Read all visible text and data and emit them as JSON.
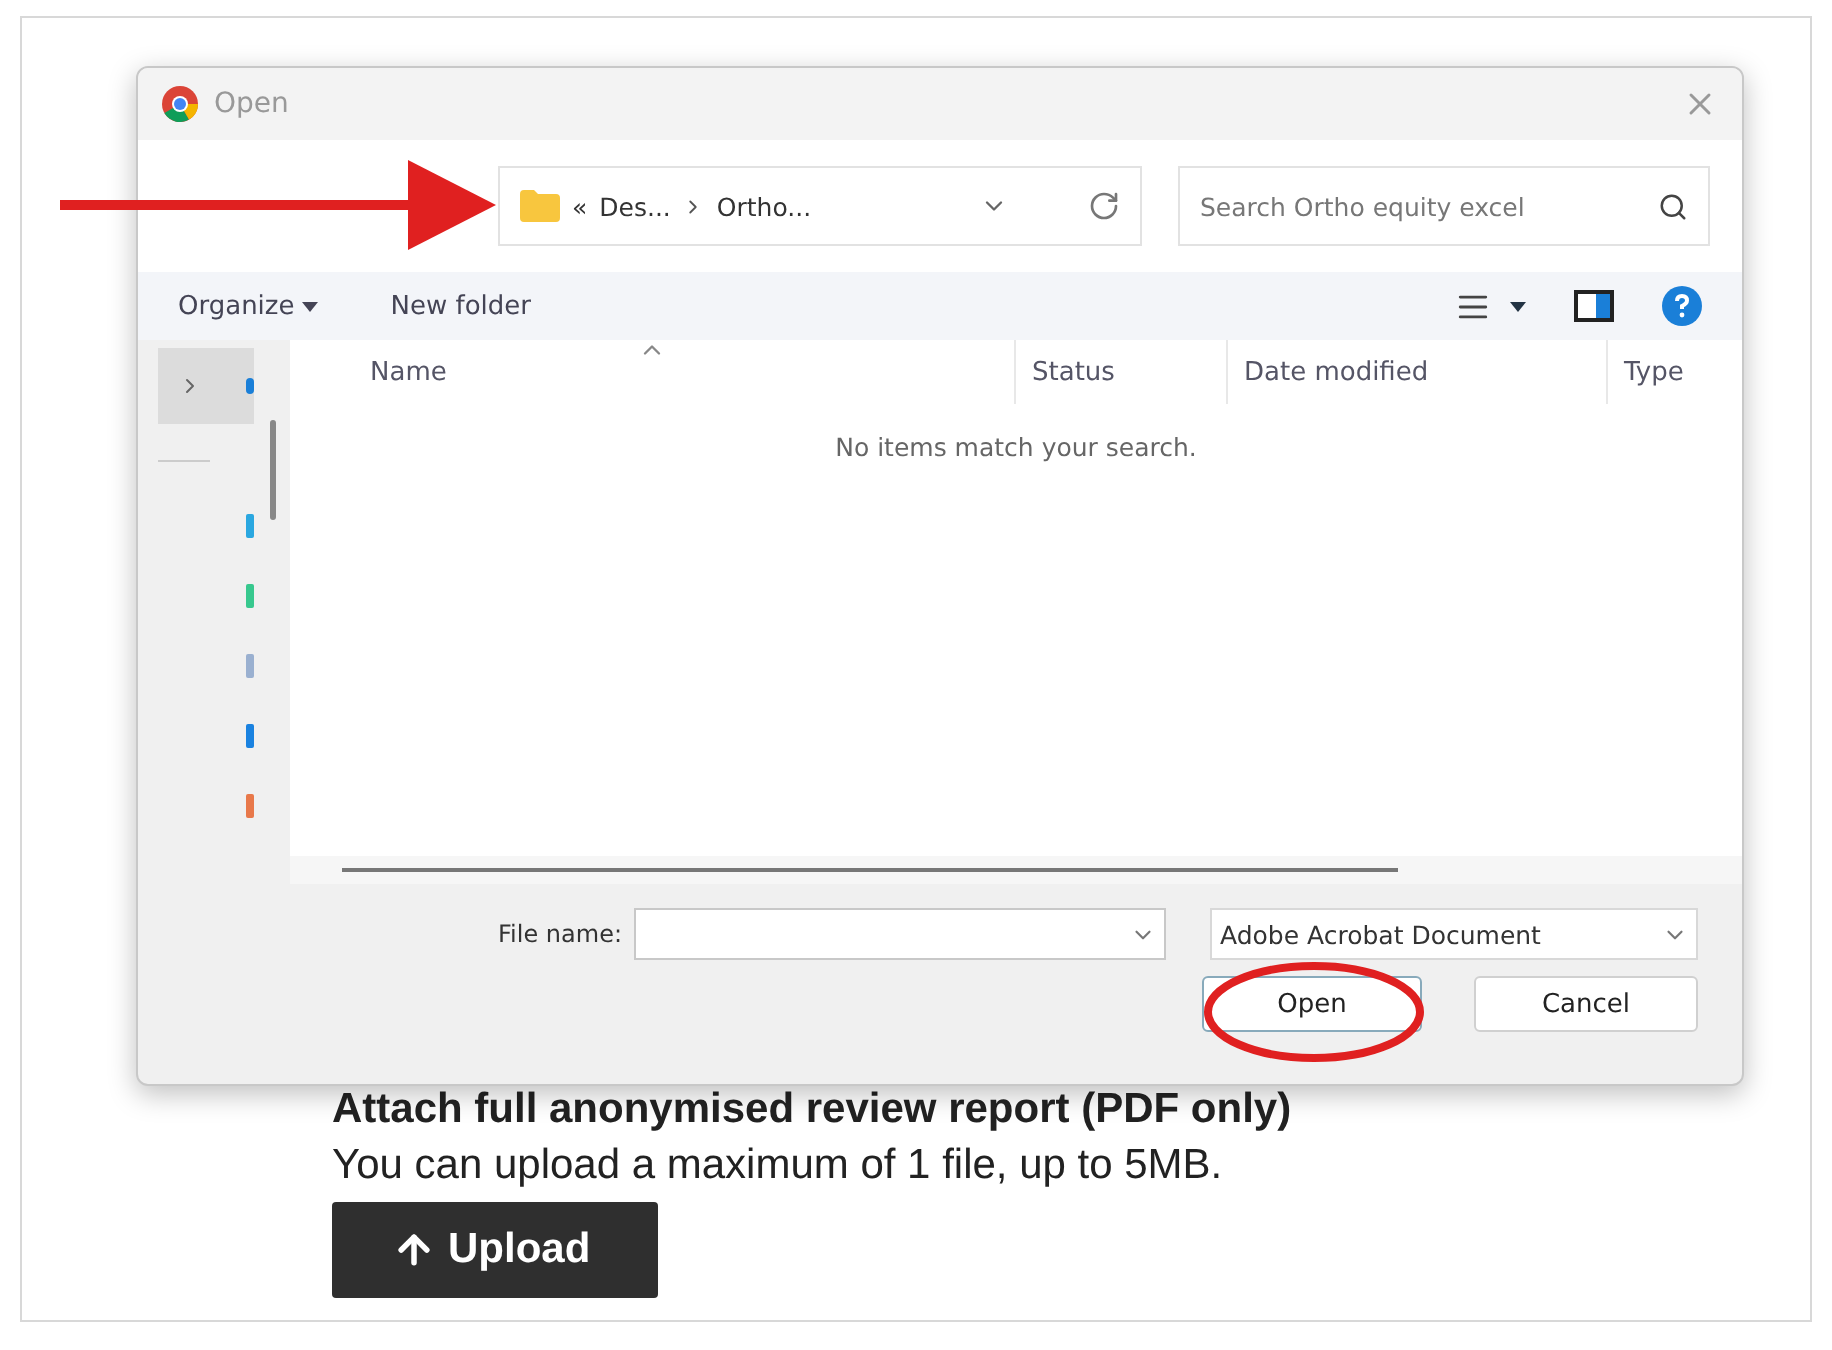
{
  "dialog": {
    "title": "Open",
    "address": {
      "overflow": "«",
      "segments": [
        "Des...",
        "Ortho..."
      ]
    },
    "search": {
      "placeholder": "Search Ortho equity excel"
    },
    "toolbar": {
      "organize": "Organize",
      "new_folder": "New folder"
    },
    "columns": [
      {
        "label": "Name",
        "sorted": true
      },
      {
        "label": "Status",
        "sorted": false
      },
      {
        "label": "Date modified",
        "sorted": false
      },
      {
        "label": "Type",
        "sorted": false
      }
    ],
    "empty_message": "No items match your search.",
    "file_name": {
      "label": "File name:"
    },
    "file_type": "Adobe Acrobat Document",
    "buttons": [
      {
        "label": "Open",
        "kind": "primary"
      },
      {
        "label": "Cancel",
        "kind": "default"
      }
    ]
  },
  "page": {
    "heading": "Attach full anonymised review report (PDF only)",
    "hint": "You can upload a maximum of 1 file, up to 5MB.",
    "upload": {
      "label": "Upload"
    }
  }
}
